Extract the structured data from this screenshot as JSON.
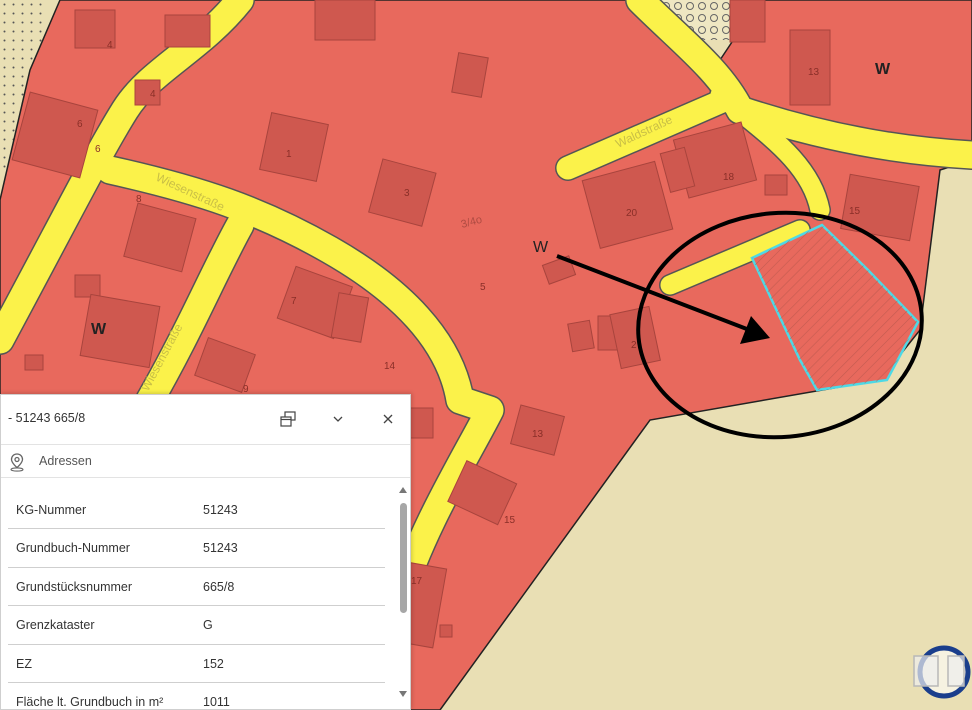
{
  "map": {
    "zone_labels": [
      "W",
      "W",
      "W"
    ],
    "street_labels": [
      "Wiesenstraße",
      "Wiesenstraße",
      "Waldstraße"
    ],
    "house_numbers": [
      "4",
      "4",
      "6",
      "6",
      "8",
      "1",
      "3",
      "5",
      "7",
      "9",
      "14",
      "13",
      "15",
      "17",
      "20",
      "18",
      "15",
      "13",
      "2"
    ],
    "parcel_label": "3/4o",
    "colors": {
      "zone": "#e8695d",
      "road": "#fbf24a",
      "building": "#cf584f",
      "open_land": "#e9dfb4",
      "highlight": "#4dd9e6",
      "annotation": "#000000"
    }
  },
  "panel": {
    "title": "- 51243 665/8",
    "icons": {
      "restore": "restore-window-icon",
      "collapse": "chevron-down-icon",
      "close": "close-icon",
      "location": "map-pin-icon"
    },
    "address_label": "Adressen",
    "rows": [
      {
        "key": "KG-Nummer",
        "value": "51243"
      },
      {
        "key": "Grundbuch-Nummer",
        "value": "51243"
      },
      {
        "key": "Grundstücksnummer",
        "value": "665/8"
      },
      {
        "key": "Grenzkataster",
        "value": "G"
      },
      {
        "key": "EZ",
        "value": "152"
      },
      {
        "key": "Fläche lt. Grundbuch in m²",
        "value": "1011"
      }
    ]
  }
}
